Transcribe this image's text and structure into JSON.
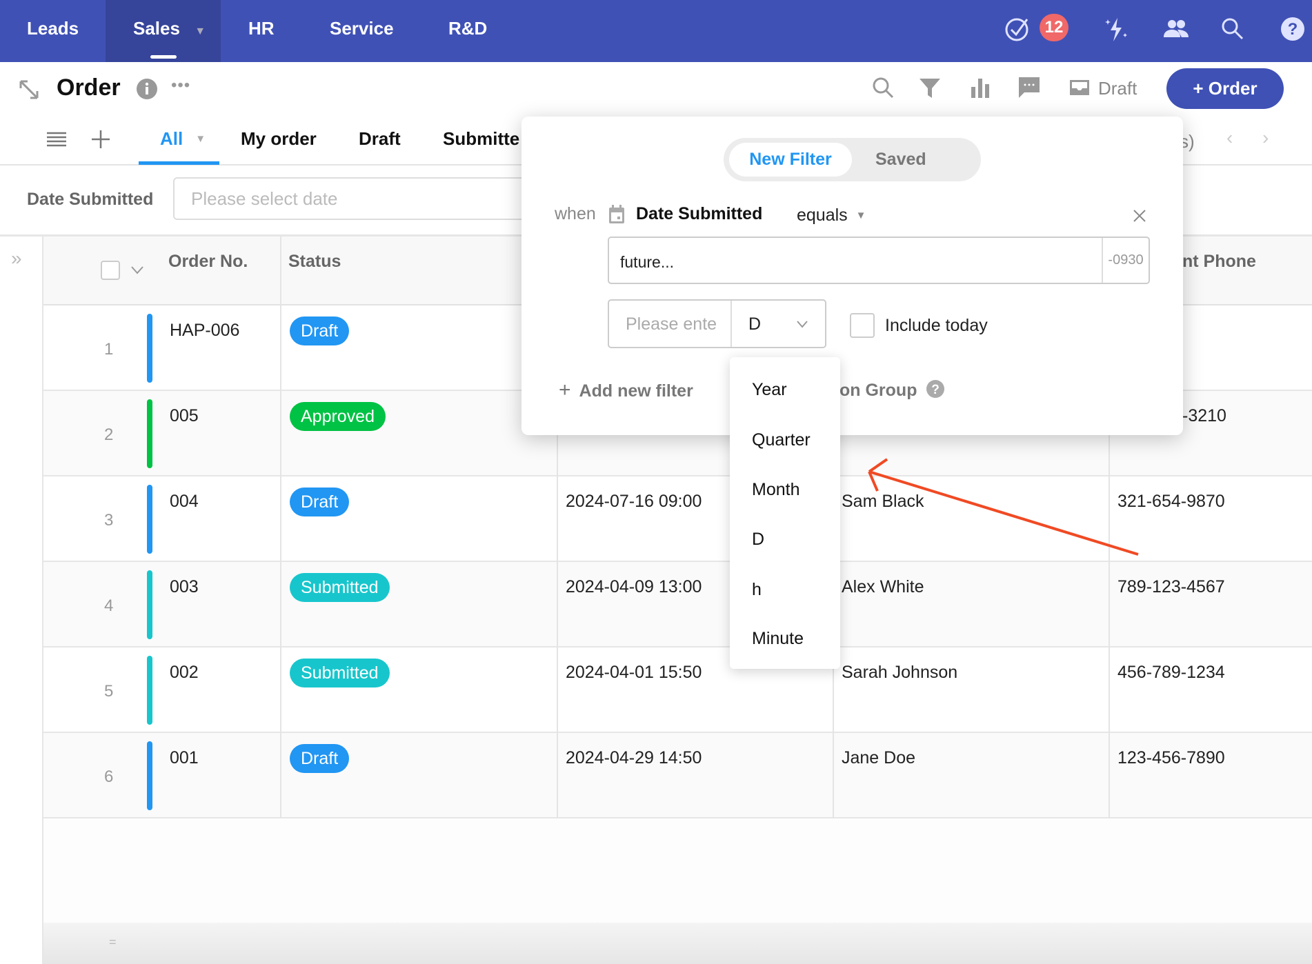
{
  "nav": {
    "tabs": [
      "Leads",
      "Sales",
      "HR",
      "Service",
      "R&D"
    ],
    "active": "Sales",
    "notification_count": "12",
    "icons": [
      "check-circle-icon",
      "sparkle-icon",
      "people-icon",
      "search-icon",
      "help-icon"
    ]
  },
  "header": {
    "title": "Order",
    "draft_label": "Draft",
    "add_button": "+ Order"
  },
  "views": {
    "tabs": [
      "All",
      "My order",
      "Draft",
      "Submitte"
    ],
    "active": "All",
    "partial_right": "s)"
  },
  "filterbar": {
    "label": "Date Submitted",
    "placeholder": "Please select date"
  },
  "table": {
    "columns": [
      "Order No.",
      "Status",
      "",
      "",
      "nt Phone"
    ],
    "rows": [
      {
        "n": "1",
        "order": "HAP-006",
        "status": "Draft",
        "date": "",
        "customer": "",
        "phone": ""
      },
      {
        "n": "2",
        "order": "005",
        "status": "Approved",
        "date": "",
        "customer": "",
        "phone": "-3210"
      },
      {
        "n": "3",
        "order": "004",
        "status": "Draft",
        "date": "2024-07-16 09:00",
        "customer": "Sam Black",
        "phone": "321-654-9870"
      },
      {
        "n": "4",
        "order": "003",
        "status": "Submitted",
        "date": "2024-04-09 13:00",
        "customer": "Alex White",
        "phone": "789-123-4567"
      },
      {
        "n": "5",
        "order": "002",
        "status": "Submitted",
        "date": "2024-04-01 15:50",
        "customer": "Sarah Johnson",
        "phone": "456-789-1234"
      },
      {
        "n": "6",
        "order": "001",
        "status": "Draft",
        "date": "2024-04-29 14:50",
        "customer": "Jane Doe",
        "phone": "123-456-7890"
      }
    ],
    "status_colors": {
      "Draft": "#2196f3",
      "Approved": "#00c244",
      "Submitted": "#17c6cc"
    }
  },
  "popup": {
    "tabs": {
      "new": "New Filter",
      "saved": "Saved"
    },
    "when": "when",
    "field": "Date Submitted",
    "operator": "equals",
    "value": "future...",
    "value_suffix": "-0930",
    "number_placeholder": "Please ente",
    "unit": "D",
    "include_today": "Include today",
    "add_filter": "Add new filter",
    "group_partial": "on Group"
  },
  "unit_dropdown": {
    "options": [
      "Year",
      "Quarter",
      "Month",
      "D",
      "h",
      "Minute"
    ]
  },
  "colors": {
    "nav": "#4051b5",
    "accent": "#2196f3",
    "annotation_arrow": "#f04a24"
  }
}
